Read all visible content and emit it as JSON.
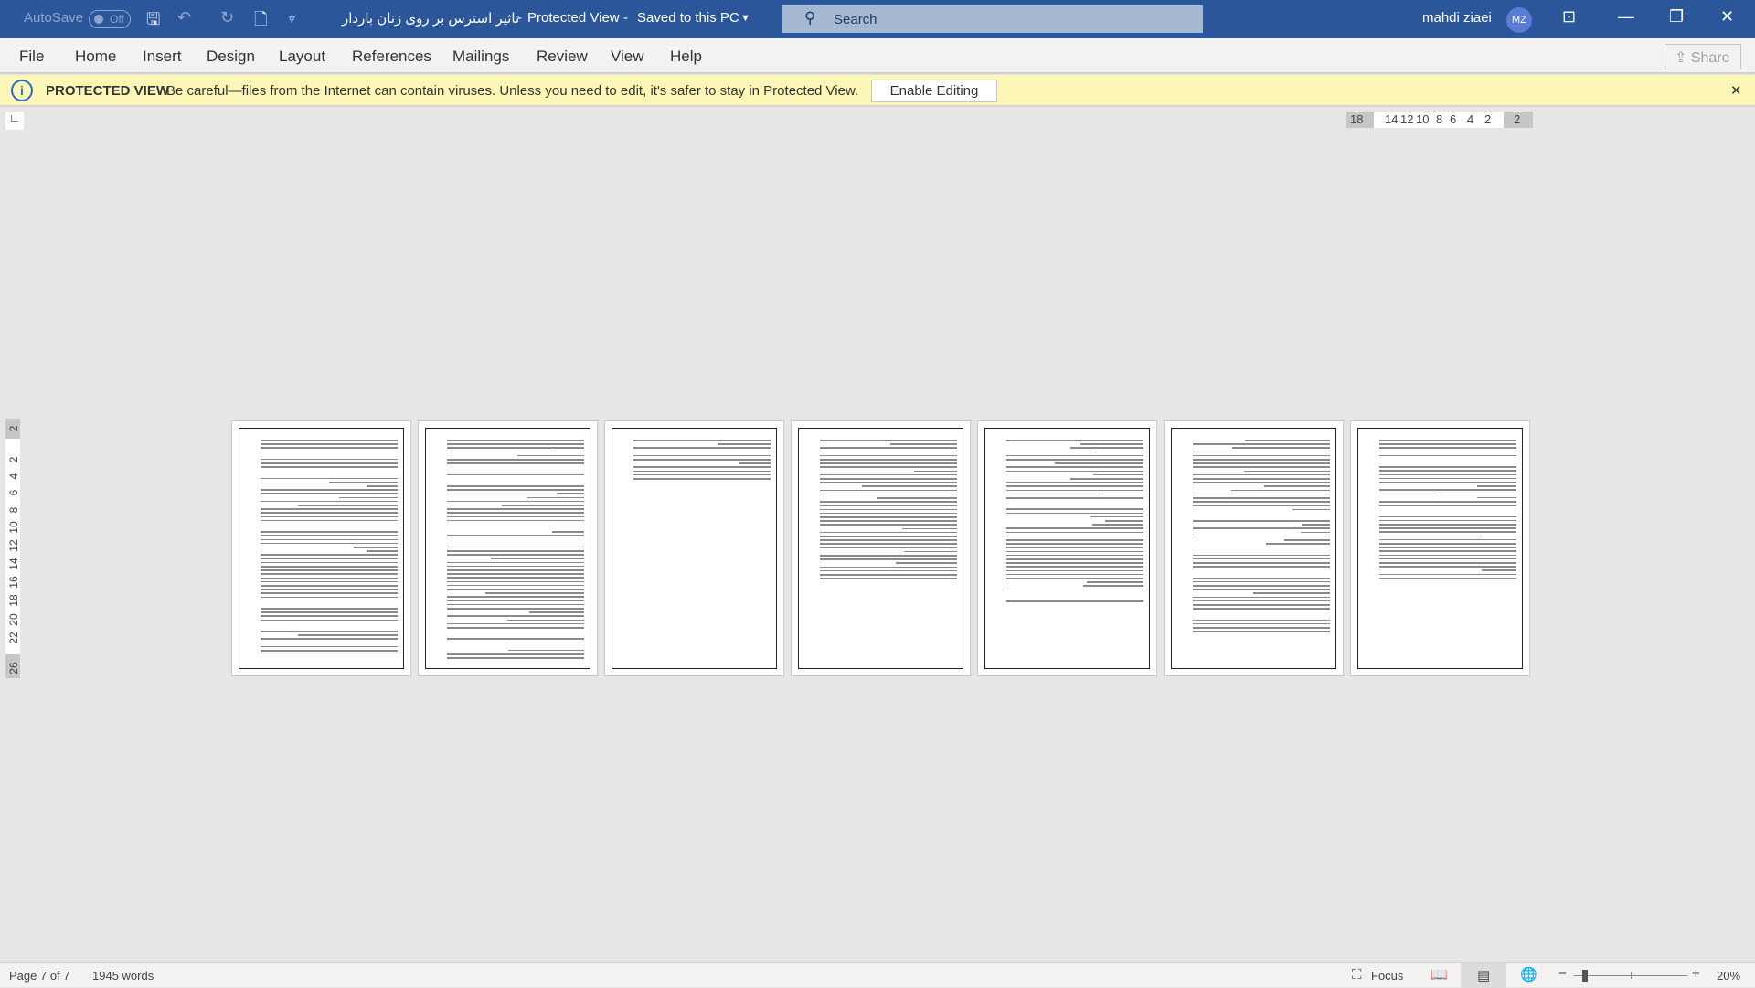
{
  "titlebar": {
    "autosave_label": "AutoSave",
    "autosave_state": "Off",
    "document_title": "تاثیر استرس بر روی زنان باردار",
    "view_state": "Protected View",
    "save_state": "Saved to this PC",
    "search_placeholder": "Search",
    "user_name": "mahdi ziaei",
    "user_initials": "MZ"
  },
  "menu": {
    "items": [
      "File",
      "Home",
      "Insert",
      "Design",
      "Layout",
      "References",
      "Mailings",
      "Review",
      "View",
      "Help"
    ],
    "share": "Share"
  },
  "protected_bar": {
    "title": "PROTECTED VIEW",
    "message": "Be careful—files from the Internet can contain viruses. Unless you need to edit, it's safer to stay in Protected View.",
    "enable_button": "Enable Editing"
  },
  "ruler": {
    "horizontal": [
      "18",
      "14",
      "12",
      "10",
      "8",
      "6",
      "4",
      "2",
      "2"
    ],
    "vertical": [
      "2",
      "2",
      "4",
      "6",
      "8",
      "10",
      "12",
      "14",
      "16",
      "18",
      "20",
      "22",
      "26"
    ]
  },
  "document": {
    "page_count": 7
  },
  "status": {
    "page": "Page 7 of 7",
    "words": "1945 words",
    "focus": "Focus",
    "zoom": "20%",
    "zoom_level_percent": 20
  },
  "colors": {
    "titlebar": "#2b579a",
    "protected_bar": "#fdf7b7"
  }
}
